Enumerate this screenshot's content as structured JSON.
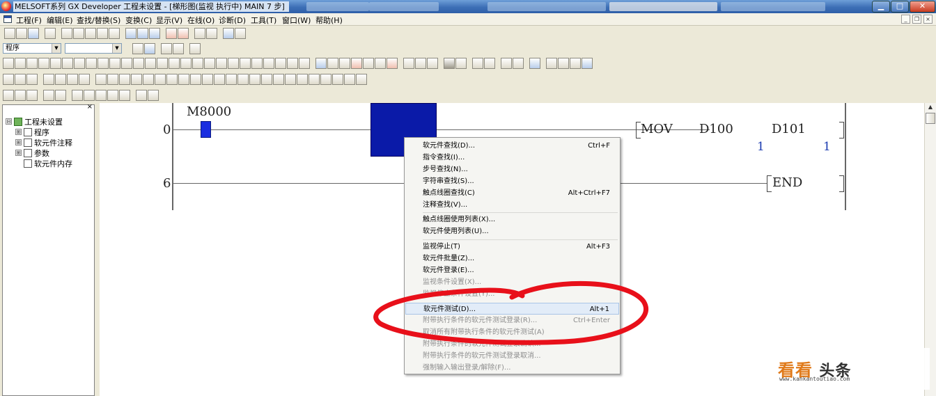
{
  "window": {
    "title": "MELSOFT系列 GX Developer 工程未设置 - [梯形图(监视 执行中)    MAIN    7 步]",
    "min_glyph": "▁",
    "max_glyph": "□",
    "close_glyph": "✕"
  },
  "menu": {
    "items": [
      "工程(F)",
      "编辑(E)",
      "查找/替换(S)",
      "变换(C)",
      "显示(V)",
      "在线(O)",
      "诊断(D)",
      "工具(T)",
      "窗口(W)",
      "帮助(H)"
    ],
    "mdi_min": "_",
    "mdi_restore": "❐",
    "mdi_close": "×"
  },
  "toolbar": {
    "program_select": "程序",
    "second_select": "",
    "select_arrow": "▼"
  },
  "tree": {
    "close": "×",
    "items": [
      {
        "label": "工程未设置",
        "expander": "⊟"
      },
      {
        "label": "程序",
        "expander": "⊞"
      },
      {
        "label": "软元件注释",
        "expander": "⊞"
      },
      {
        "label": "参数",
        "expander": "⊞"
      },
      {
        "label": "软元件内存",
        "expander": ""
      }
    ]
  },
  "ladder": {
    "rungs": [
      {
        "step": "0",
        "contact": "M8000",
        "instruction": "MOV",
        "op1": "D100",
        "op2": "D101",
        "val1": "1",
        "val2": "1"
      },
      {
        "step": "6",
        "instruction": "END"
      }
    ]
  },
  "context_menu": {
    "items": [
      {
        "label": "软元件查找(D)...",
        "shortcut": "Ctrl+F"
      },
      {
        "label": "指令查找(I)...",
        "shortcut": ""
      },
      {
        "label": "步号查找(N)...",
        "shortcut": ""
      },
      {
        "label": "字符串查找(S)...",
        "shortcut": ""
      },
      {
        "label": "触点线圈查找(C)",
        "shortcut": "Alt+Ctrl+F7"
      },
      {
        "label": "注释查找(V)...",
        "shortcut": ""
      },
      {
        "label": "触点线圈使用列表(X)...",
        "shortcut": ""
      },
      {
        "label": "软元件使用列表(U)...",
        "shortcut": ""
      },
      {
        "label": "监视停止(T)",
        "shortcut": "Alt+F3"
      },
      {
        "label": "软元件批量(Z)...",
        "shortcut": ""
      },
      {
        "label": "软元件登录(E)...",
        "shortcut": ""
      },
      {
        "label": "监视条件设置(X)...",
        "shortcut": ""
      },
      {
        "label": "监视停止条件设置(Y)...",
        "shortcut": ""
      },
      {
        "label": "软元件测试(D)...",
        "shortcut": "Alt+1"
      },
      {
        "label": "附带执行条件的软元件测试登录(R)...",
        "shortcut": "Ctrl+Enter"
      },
      {
        "label": "取消所有附带执行条件的软元件测试(A)",
        "shortcut": ""
      },
      {
        "label": "附带执行条件的软元件测试登录确认...",
        "shortcut": ""
      },
      {
        "label": "附带执行条件的软元件测试登录取消...",
        "shortcut": ""
      },
      {
        "label": "强制输入输出登录/解除(F)...",
        "shortcut": ""
      }
    ]
  },
  "watermark": {
    "brand": "看看",
    "brand_suffix": "头条",
    "url": "www.kankantoutiao.com"
  },
  "colors": {
    "selection_block": "#0a1aa8",
    "contact_fill": "#1a2ee0",
    "annotation": "#e8101a"
  }
}
